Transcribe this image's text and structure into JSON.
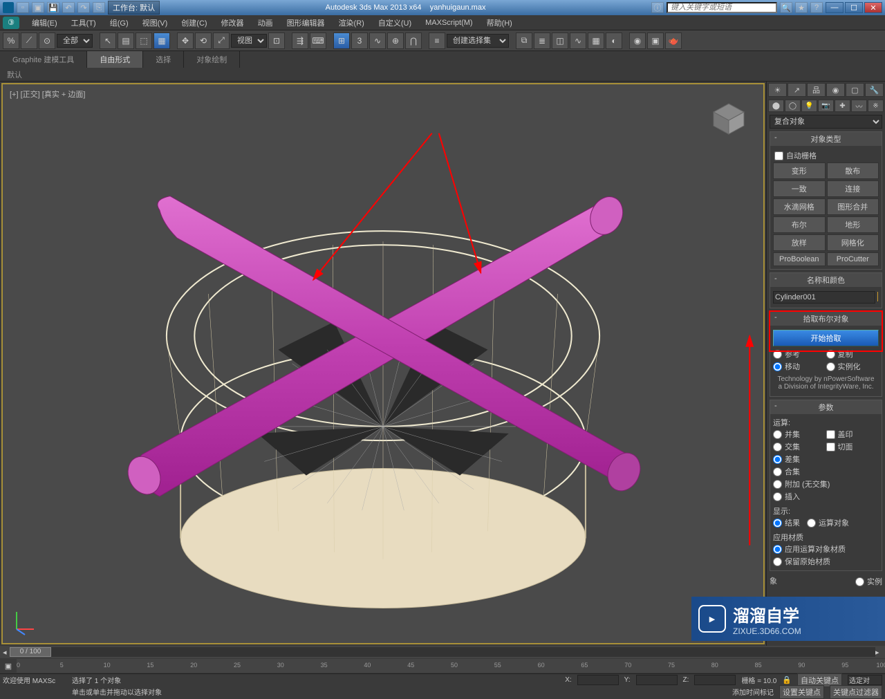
{
  "titlebar": {
    "workspace": "工作台: 默认",
    "app_title": "Autodesk 3ds Max  2013 x64",
    "filename": "yanhuigaun.max",
    "search_placeholder": "键入关键字或短语"
  },
  "menu": {
    "edit": "编辑(E)",
    "tools": "工具(T)",
    "group": "组(G)",
    "views": "视图(V)",
    "create": "创建(C)",
    "modifiers": "修改器",
    "animation": "动画",
    "graph": "图形编辑器",
    "rendering": "渲染(R)",
    "customize": "自定义(U)",
    "maxscript": "MAXScript(M)",
    "help": "帮助(H)"
  },
  "toolbar": {
    "filter": "全部",
    "view_label": "视图",
    "selset": "创建选择集"
  },
  "ribbon": {
    "tab1": "Graphite 建模工具",
    "tab2": "自由形式",
    "tab3": "选择",
    "tab4": "对象绘制",
    "sub": "默认"
  },
  "viewport": {
    "label": "[+] [正交] [真实 + 边面]"
  },
  "cmdpanel": {
    "dropdown": "复合对象",
    "rollout1_hdr": "对象类型",
    "autogrid": "自动栅格",
    "btns": {
      "morph": "变形",
      "scatter": "散布",
      "conform": "一致",
      "connect": "连接",
      "blobmesh": "水滴网格",
      "shapemerge": "图形合并",
      "boolean": "布尔",
      "terrain": "地形",
      "loft": "放样",
      "mesher": "网格化",
      "proboolean": "ProBoolean",
      "procutter": "ProCutter"
    },
    "rollout2_hdr": "名称和颜色",
    "obj_name": "Cylinder001",
    "rollout3_hdr": "拾取布尔对象",
    "pick_btn": "开始拾取",
    "ref": "参考",
    "copy": "复制",
    "move": "移动",
    "instance": "实例化",
    "tech_note": "Technology by nPowerSoftware a Division of IntegrityWare, Inc.",
    "rollout4_hdr": "参数",
    "operation_lbl": "运算:",
    "union": "并集",
    "intersect": "交集",
    "subtract": "差集",
    "merge": "合集",
    "attach": "附加 (无交集)",
    "insert": "插入",
    "imprint": "盖印",
    "cookie": "切面",
    "display_lbl": "显示:",
    "result": "结果",
    "operands": "运算对象",
    "applymat_lbl": "应用材质",
    "applymat1": "应用运算对象材质",
    "applymat2": "保留原始材质",
    "extra_obj": "象",
    "extra_inst": "实例"
  },
  "timeline": {
    "slider": "0 / 100",
    "ticks": [
      "0",
      "5",
      "10",
      "15",
      "20",
      "25",
      "30",
      "35",
      "40",
      "45",
      "50",
      "55",
      "60",
      "65",
      "70",
      "75",
      "80",
      "85",
      "90",
      "95",
      "100"
    ]
  },
  "status": {
    "welcome": "欢迎使用  MAXSc",
    "line1": "选择了 1 个对象",
    "line2": "单击或单击并拖动以选择对象",
    "x": "X:",
    "y": "Y:",
    "z": "Z:",
    "grid_lbl": "栅格 = 10.0",
    "autokey": "自动关键点",
    "setkey": "设置关键点",
    "selected": "选定对",
    "keyfilter": "关键点过滤器",
    "addtime": "添加时间标记"
  },
  "watermark": {
    "brand": "溜溜自学",
    "url": "ZIXUE.3D66.COM"
  }
}
